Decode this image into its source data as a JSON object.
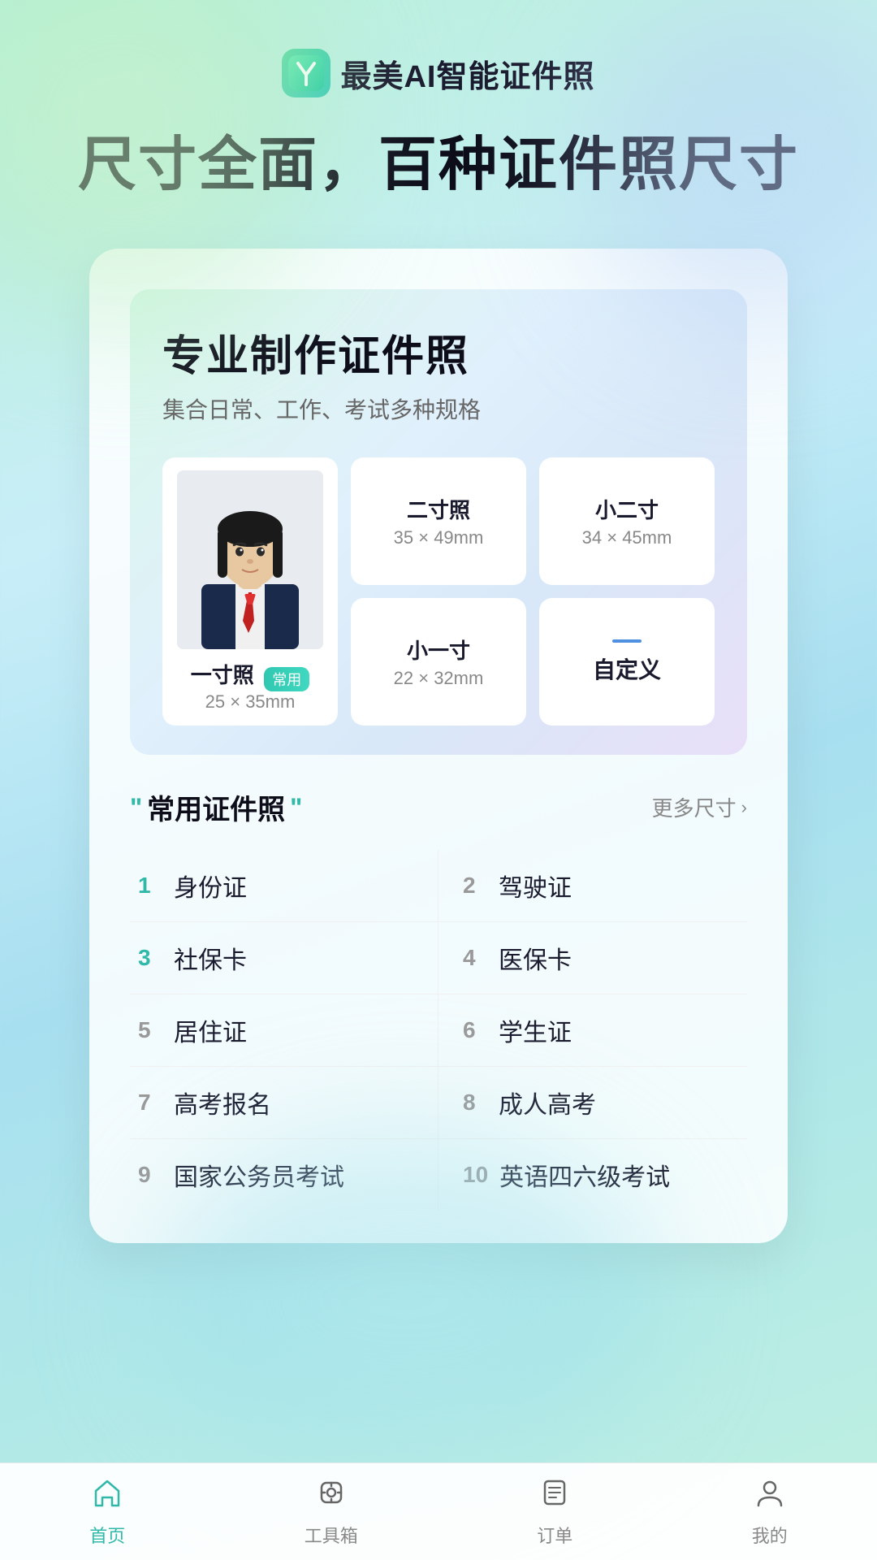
{
  "header": {
    "app_name": "最美AI智能证件照"
  },
  "hero": {
    "title": "尺寸全面，百种证件照尺寸"
  },
  "card": {
    "main_title": "专业制作证件照",
    "subtitle": "集合日常、工作、考试多种规格",
    "photo_types": [
      {
        "id": "er_cun",
        "name": "二寸照",
        "size": "35 × 49mm",
        "is_image": false
      },
      {
        "id": "xiao_er_cun",
        "name": "小二寸",
        "size": "34 × 45mm",
        "is_image": false
      },
      {
        "id": "yi_cun",
        "name": "一寸照",
        "size": "25 × 35mm",
        "badge": "常用",
        "is_main": true
      },
      {
        "id": "xiao_yi_cun",
        "name": "小一寸",
        "size": "22 × 32mm",
        "is_image": false
      },
      {
        "id": "custom",
        "name": "自定义",
        "is_custom": true
      }
    ],
    "section": {
      "title": "常用证件照",
      "more_label": "更多尺寸",
      "more_chevron": "›"
    },
    "id_types": [
      {
        "number": "1",
        "name": "身份证",
        "colored": true
      },
      {
        "number": "2",
        "name": "驾驶证",
        "colored": false
      },
      {
        "number": "3",
        "name": "社保卡",
        "colored": true
      },
      {
        "number": "4",
        "name": "医保卡",
        "colored": false
      },
      {
        "number": "5",
        "name": "居住证",
        "colored": false
      },
      {
        "number": "6",
        "name": "学生证",
        "colored": false
      },
      {
        "number": "7",
        "name": "高考报名",
        "colored": false
      },
      {
        "number": "8",
        "name": "成人高考",
        "colored": false
      },
      {
        "number": "9",
        "name": "国家公务员考试",
        "colored": false
      },
      {
        "number": "10",
        "name": "英语四六级考试",
        "colored": false
      }
    ]
  },
  "nav": {
    "items": [
      {
        "id": "home",
        "label": "首页",
        "active": true
      },
      {
        "id": "tools",
        "label": "工具箱",
        "active": false
      },
      {
        "id": "orders",
        "label": "订单",
        "active": false
      },
      {
        "id": "profile",
        "label": "我的",
        "active": false
      }
    ]
  }
}
